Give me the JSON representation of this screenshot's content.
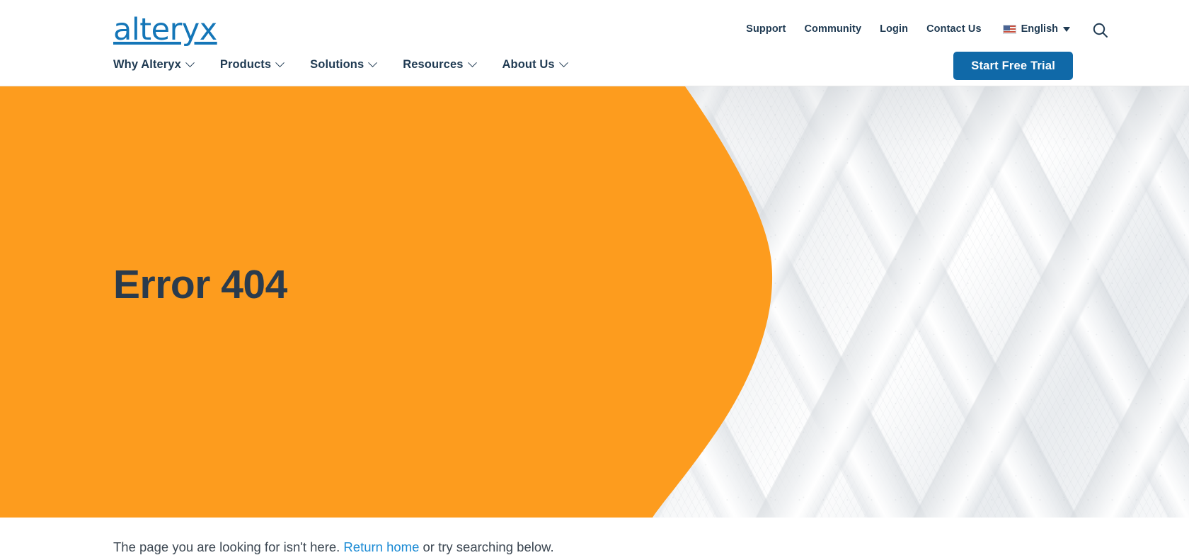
{
  "brand": {
    "logo_text": "alteryx",
    "logo_color": "#1476b8",
    "accent_orange": "#FD9C1E",
    "navy": "#1f3a52",
    "cta_blue": "#1069a8",
    "link_blue": "#1a8ad4"
  },
  "header": {
    "utility_links": [
      {
        "label": "Support"
      },
      {
        "label": "Community"
      },
      {
        "label": "Login"
      },
      {
        "label": "Contact Us"
      }
    ],
    "language": {
      "label": "English",
      "flag_icon": "us-flag-icon",
      "caret_icon": "caret-down-icon"
    },
    "search_icon": "search-icon",
    "nav_items": [
      {
        "label": "Why Alteryx",
        "icon": "chevron-down-icon"
      },
      {
        "label": "Products",
        "icon": "chevron-down-icon"
      },
      {
        "label": "Solutions",
        "icon": "chevron-down-icon"
      },
      {
        "label": "Resources",
        "icon": "chevron-down-icon"
      },
      {
        "label": "About Us",
        "icon": "chevron-down-icon"
      }
    ],
    "cta_label": "Start Free Trial"
  },
  "hero": {
    "title": "Error 404",
    "background_image": "grayscale-architecture-photo"
  },
  "body": {
    "lead_before": "The page you are looking for isn't here. ",
    "lead_link": "Return home",
    "lead_after": " or try searching below."
  }
}
